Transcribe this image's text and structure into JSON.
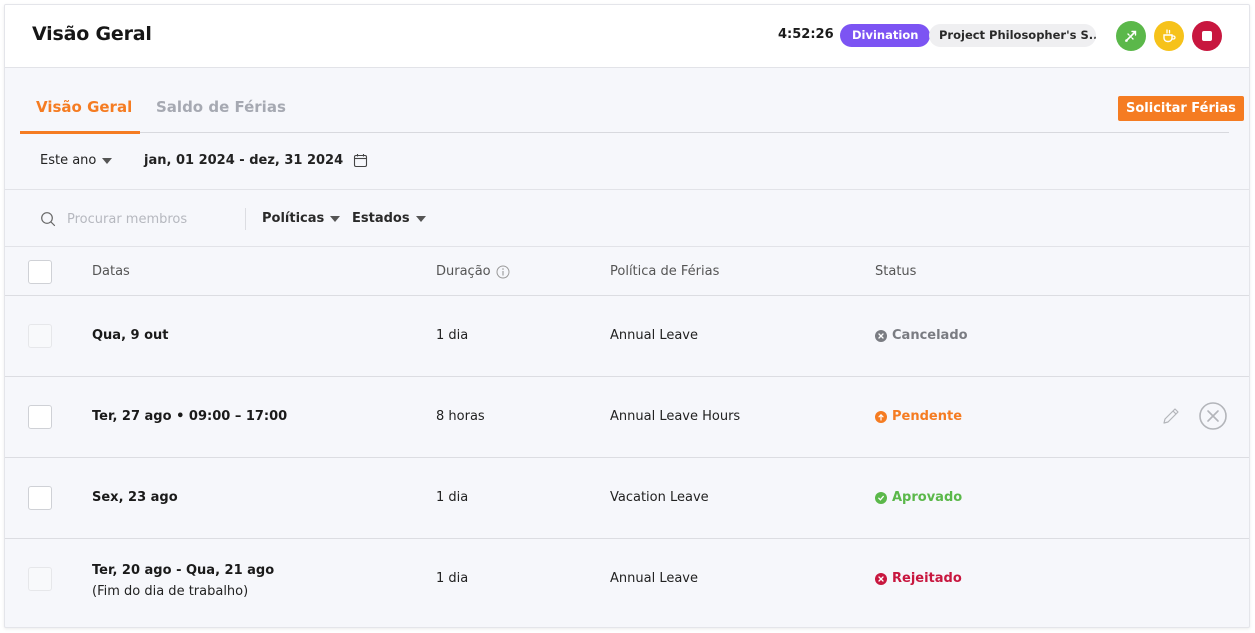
{
  "header": {
    "title": "Visão Geral",
    "timer": "4:52:26",
    "project_tag": "Divination",
    "project_name": "Project Philosopher's S...",
    "buttons": [
      {
        "name": "switch-task",
        "icon": "switch-icon",
        "color": "#5bb84a"
      },
      {
        "name": "take-break",
        "icon": "coffee-icon",
        "color": "#f6c21a"
      },
      {
        "name": "stop-timer",
        "icon": "stop-icon",
        "color": "#c8173f"
      }
    ]
  },
  "tabs": [
    {
      "label": "Visão Geral",
      "active": true
    },
    {
      "label": "Saldo de Férias",
      "active": false
    }
  ],
  "request_button": "Solicitar Férias",
  "range": {
    "period": "Este ano",
    "dates": "jan, 01 2024 - dez, 31 2024"
  },
  "filters": {
    "search_placeholder": "Procurar membros",
    "search_value": "",
    "policies": "Políticas",
    "states": "Estados"
  },
  "table": {
    "columns": {
      "dates": "Datas",
      "duration": "Duração",
      "policy": "Política de Férias",
      "status": "Status"
    },
    "rows": [
      {
        "date": "Qua, 9 out",
        "sub": "",
        "duration": "1 dia",
        "policy": "Annual Leave",
        "status": "Cancelado",
        "status_type": "cancelled",
        "status_color": "#7a7c82",
        "selectable": false,
        "actions": false
      },
      {
        "date": "Ter, 27 ago • 09:00 – 17:00",
        "sub": "",
        "duration": "8 horas",
        "policy": "Annual Leave Hours",
        "status": "Pendente",
        "status_type": "pending",
        "status_color": "#f57c22",
        "selectable": true,
        "actions": true
      },
      {
        "date": "Sex, 23 ago",
        "sub": "",
        "duration": "1 dia",
        "policy": "Vacation Leave",
        "status": "Aprovado",
        "status_type": "approved",
        "status_color": "#5bb84a",
        "selectable": true,
        "actions": false
      },
      {
        "date": "Ter, 20 ago - Qua, 21 ago",
        "sub": "(Fim do dia de trabalho)",
        "duration": "1 dia",
        "policy": "Annual Leave",
        "status": "Rejeitado",
        "status_type": "rejected",
        "status_color": "#c8173f",
        "selectable": false,
        "actions": false
      }
    ]
  },
  "colors": {
    "accent": "#f57c22",
    "project_tag": "#7c54f3"
  }
}
